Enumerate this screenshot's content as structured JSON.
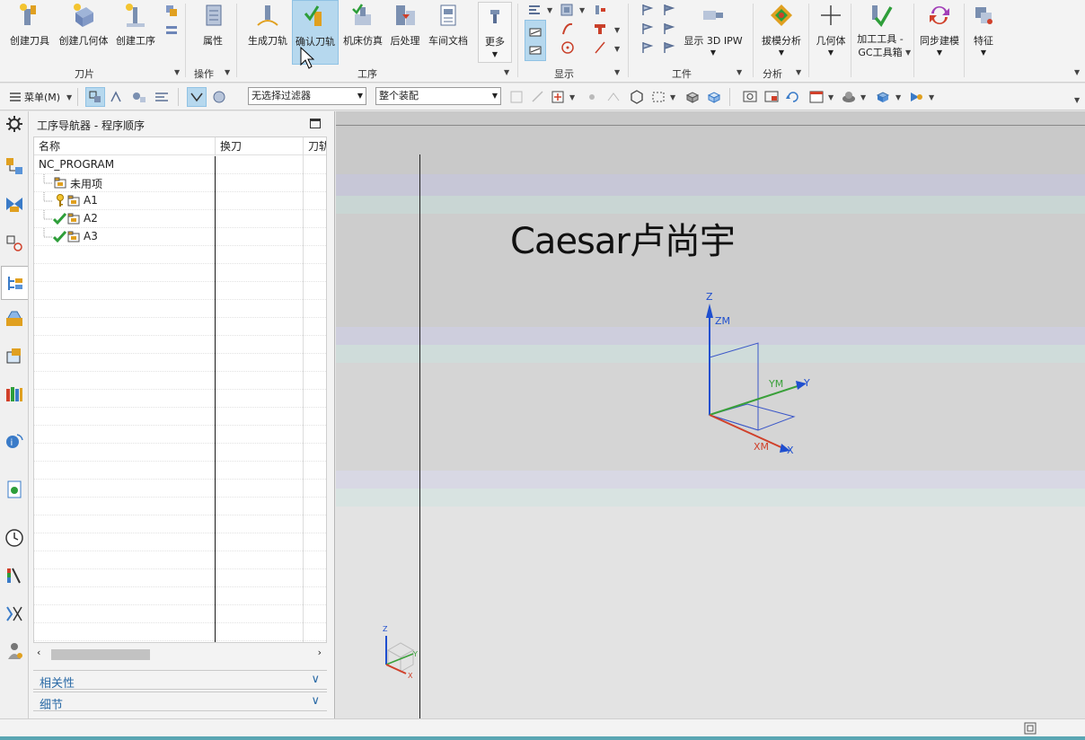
{
  "ribbon": {
    "buttons": {
      "create_tool": "创建刀具",
      "create_geometry": "创建几何体",
      "create_operation": "创建工序",
      "properties": "属性",
      "generate_toolpath": "生成刀轨",
      "verify_toolpath": "确认刀轨",
      "machine_simulation": "机床仿真",
      "postprocess": "后处理",
      "shop_docs": "车间文档",
      "more": "更多",
      "show_3d_ipw": "显示 3D IPW",
      "draft_analysis": "拔模分析",
      "geometry": "几何体",
      "machining_tool_line1": "加工工具 -",
      "machining_tool_line2": "GC工具箱",
      "synchronous_modeling": "同步建模",
      "feature": "特征"
    },
    "groups": {
      "insert": "刀片",
      "operations": "操作",
      "operation": "工序",
      "display": "显示",
      "workpiece": "工件",
      "analysis": "分析"
    }
  },
  "toolbar": {
    "menu": "菜单(M)",
    "selection_filter": "无选择过滤器",
    "assembly_scope": "整个装配"
  },
  "navigator": {
    "title": "工序导航器 - 程序顺序",
    "columns": [
      "名称",
      "换刀",
      "刀轨"
    ],
    "rows": [
      {
        "name": "NC_PROGRAM",
        "status": "none"
      },
      {
        "name": "未用项",
        "status": "none"
      },
      {
        "name": "A1",
        "status": "regenerate"
      },
      {
        "name": "A2",
        "status": "complete"
      },
      {
        "name": "A3",
        "status": "complete"
      }
    ],
    "panels": [
      "相关性",
      "细节"
    ]
  },
  "graphics": {
    "watermark": "Caesar卢尚宇",
    "csys_labels": {
      "z": "Z",
      "zm": "ZM",
      "y": "Y",
      "ym": "YM",
      "x": "X",
      "xm": "XM"
    },
    "mini_csys_labels": {
      "z": "Z",
      "y": "Y",
      "x": "X"
    }
  },
  "colors": {
    "accent_active": "#b6d8ee",
    "check_green": "#2e9e3a",
    "axis_blue": "#1f4fcf",
    "axis_green": "#3aa03a",
    "axis_red": "#d0402a",
    "link_blue": "#2a6aa6"
  }
}
